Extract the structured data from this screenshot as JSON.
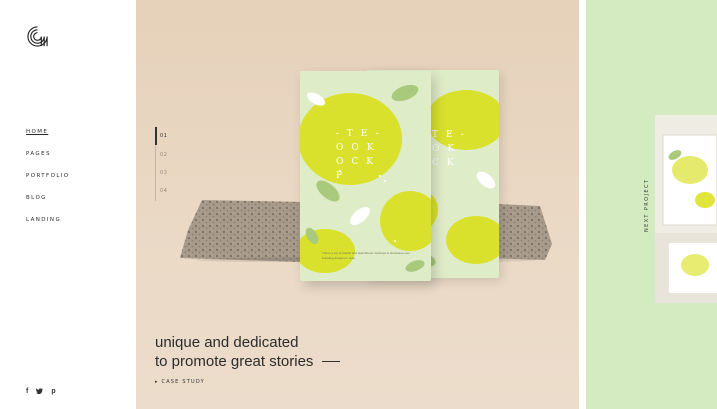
{
  "sidebar": {
    "nav": [
      {
        "label": "HOME",
        "active": true
      },
      {
        "label": "PAGES",
        "active": false
      },
      {
        "label": "PORTFOLIO",
        "active": false
      },
      {
        "label": "BLOG",
        "active": false
      },
      {
        "label": "LANDING",
        "active": false
      }
    ],
    "social": {
      "facebook": "f",
      "twitter": "ᵛ",
      "pinterest": "p"
    }
  },
  "slider": {
    "numbers": [
      "01",
      "02",
      "03",
      "04"
    ],
    "active_index": 0
  },
  "product": {
    "cover_text": "-TE-\nOOK\nOCK\nP",
    "cover_text_back": "TE-\nOK\nCK",
    "caption": "This is a set of classic and sketchbook mockups to showcase your branding designs in style."
  },
  "hero": {
    "tagline_line1": "unique and dedicated",
    "tagline_line2": "to promote great stories",
    "case_study": "▸ CASE STUDY"
  },
  "next": {
    "label": "NEXT PROJECT"
  },
  "colors": {
    "hero_bg": "#e8d5c0",
    "next_bg": "#d4eac0",
    "lemon": "#d7e02c",
    "leaf": "#a9c97c"
  }
}
